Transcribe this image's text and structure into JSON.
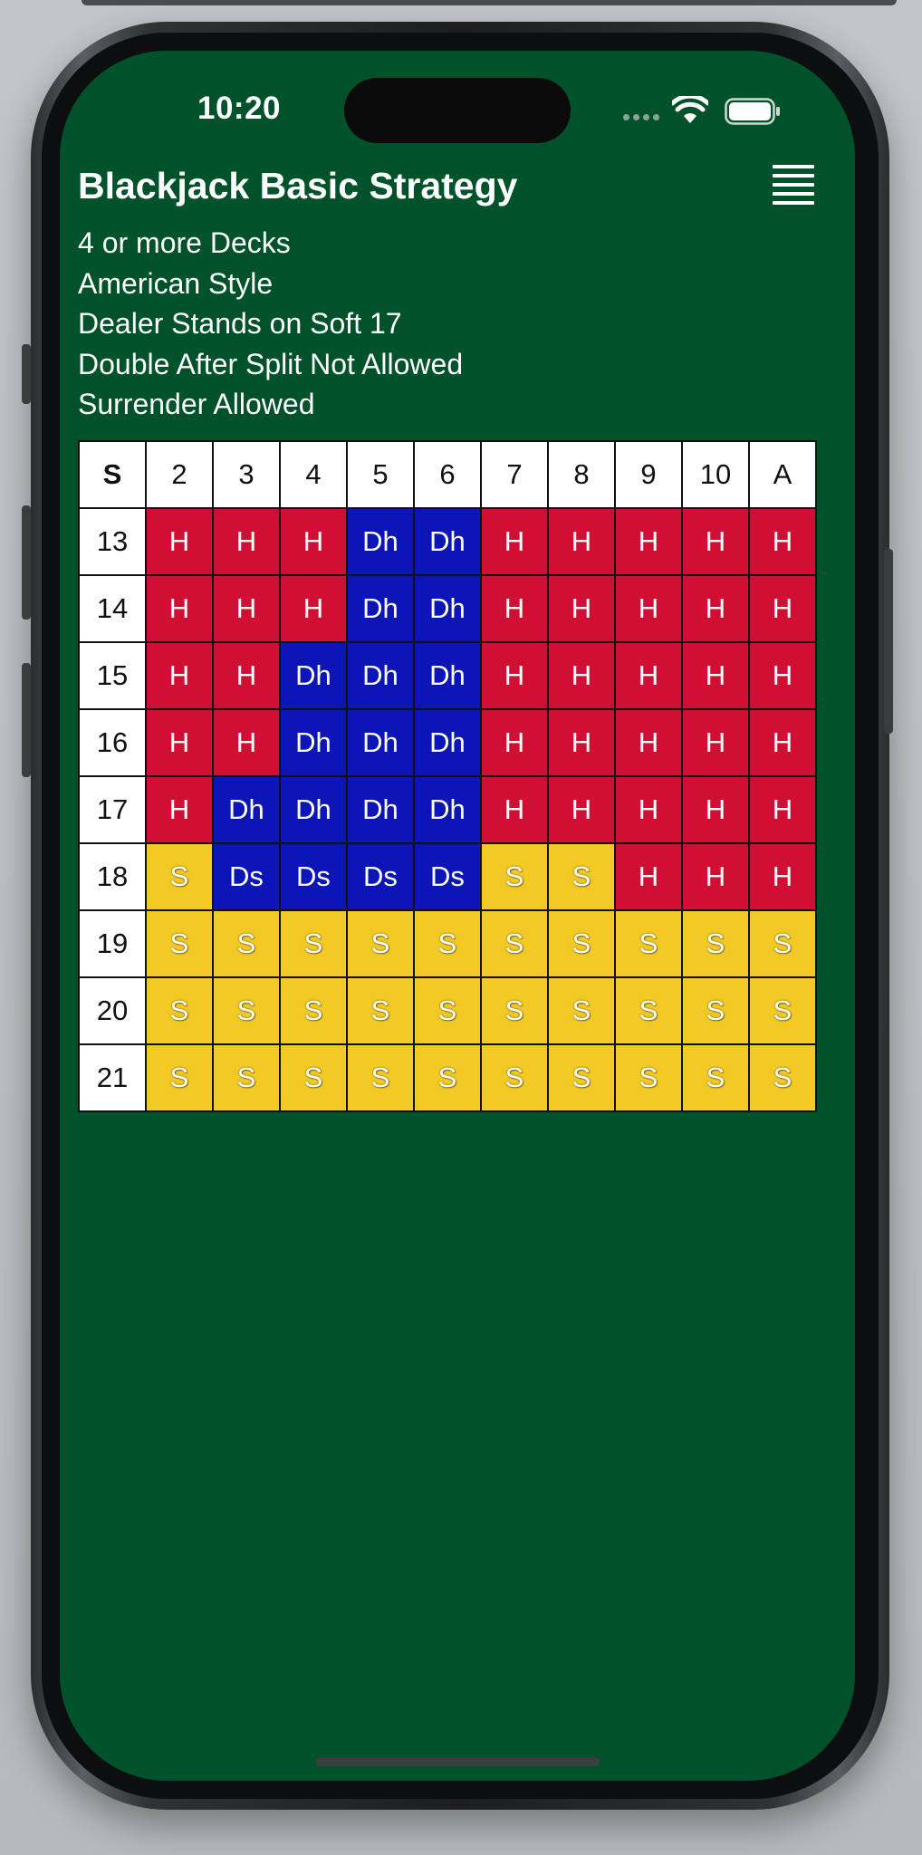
{
  "status_bar": {
    "time": "10:20"
  },
  "header": {
    "title": "Blackjack Basic Strategy"
  },
  "rules": [
    "4 or more Decks",
    "American Style",
    "Dealer Stands on Soft 17",
    "Double After Split Not Allowed",
    "Surrender Allowed"
  ],
  "table": {
    "corner": "S",
    "columns": [
      "2",
      "3",
      "4",
      "5",
      "6",
      "7",
      "8",
      "9",
      "10",
      "A"
    ],
    "rows": [
      {
        "label": "13",
        "cells": [
          "H",
          "H",
          "H",
          "Dh",
          "Dh",
          "H",
          "H",
          "H",
          "H",
          "H"
        ]
      },
      {
        "label": "14",
        "cells": [
          "H",
          "H",
          "H",
          "Dh",
          "Dh",
          "H",
          "H",
          "H",
          "H",
          "H"
        ]
      },
      {
        "label": "15",
        "cells": [
          "H",
          "H",
          "Dh",
          "Dh",
          "Dh",
          "H",
          "H",
          "H",
          "H",
          "H"
        ]
      },
      {
        "label": "16",
        "cells": [
          "H",
          "H",
          "Dh",
          "Dh",
          "Dh",
          "H",
          "H",
          "H",
          "H",
          "H"
        ]
      },
      {
        "label": "17",
        "cells": [
          "H",
          "Dh",
          "Dh",
          "Dh",
          "Dh",
          "H",
          "H",
          "H",
          "H",
          "H"
        ]
      },
      {
        "label": "18",
        "cells": [
          "S",
          "Ds",
          "Ds",
          "Ds",
          "Ds",
          "S",
          "S",
          "H",
          "H",
          "H"
        ]
      },
      {
        "label": "19",
        "cells": [
          "S",
          "S",
          "S",
          "S",
          "S",
          "S",
          "S",
          "S",
          "S",
          "S"
        ]
      },
      {
        "label": "20",
        "cells": [
          "S",
          "S",
          "S",
          "S",
          "S",
          "S",
          "S",
          "S",
          "S",
          "S"
        ]
      },
      {
        "label": "21",
        "cells": [
          "S",
          "S",
          "S",
          "S",
          "S",
          "S",
          "S",
          "S",
          "S",
          "S"
        ]
      }
    ]
  },
  "colors": {
    "background": "#00522a",
    "hit": "#d10e33",
    "double": "#0c16b6",
    "stand": "#f2c925"
  },
  "icons": {
    "menu": "menu-icon",
    "wifi": "wifi-icon",
    "battery": "battery-icon",
    "signal": "signal-icon"
  }
}
